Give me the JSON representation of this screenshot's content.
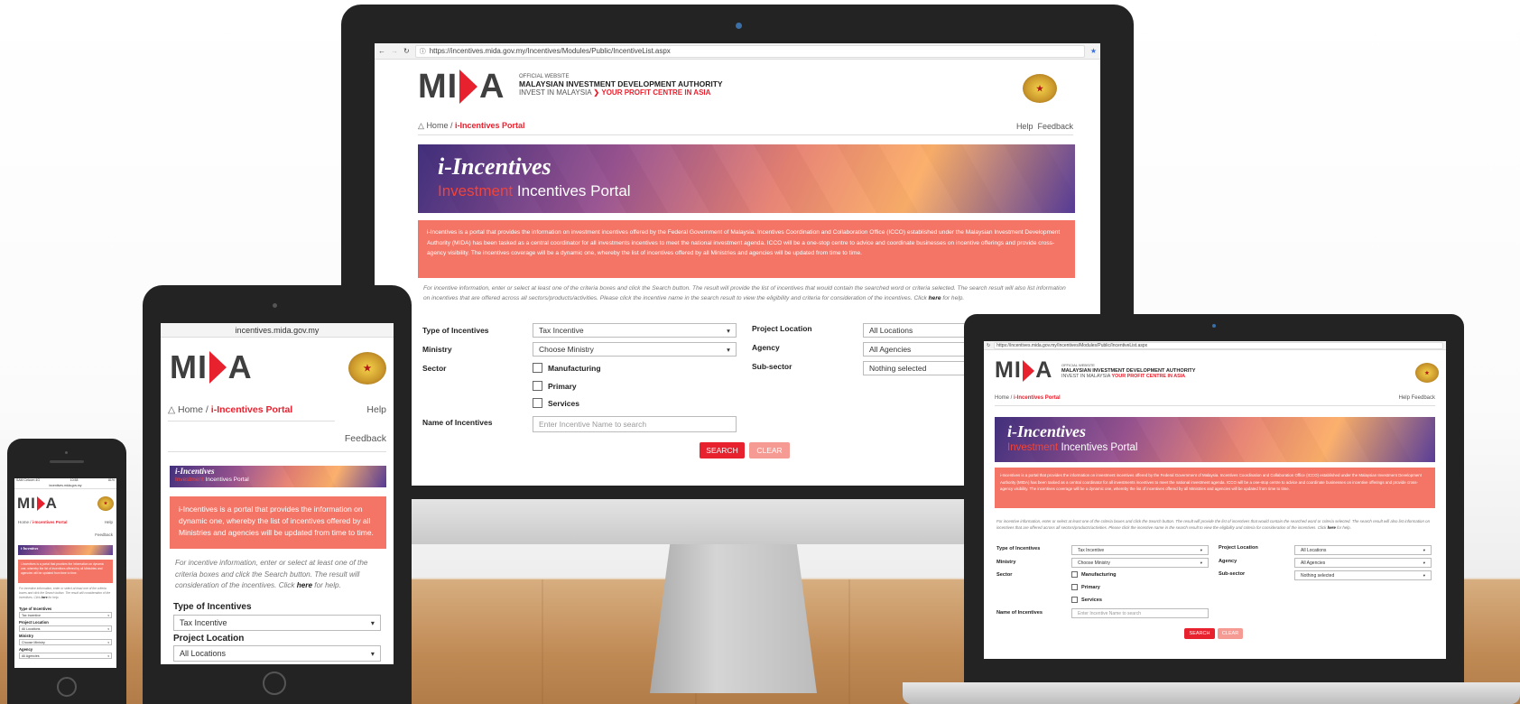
{
  "browser": {
    "url": "https://incentives.mida.gov.my/Incentives/Modules/Public/IncentiveList.aspx",
    "mobile_url": "incentives.mida.gov.my",
    "phone_time": "10:58",
    "phone_carrier": "SAM Celcom 4G",
    "phone_battery": "81%"
  },
  "logo": {
    "text_a": "MI",
    "text_b": "A"
  },
  "header": {
    "official": "OFFICIAL WEBSITE",
    "org": "MALAYSIAN INVESTMENT DEVELOPMENT AUTHORITY",
    "tagline_a": "INVEST IN MALAYSIA",
    "tagline_b": "YOUR PROFIT CENTRE IN ASIA"
  },
  "nav": {
    "home": "Home",
    "current": "i-Incentives Portal",
    "help": "Help",
    "feedback": "Feedback"
  },
  "banner": {
    "title": "i-Incentives",
    "sub_red": "Investment",
    "sub_white": "Incentives Portal"
  },
  "intro": {
    "text": "i-Incentives is a portal that provides the information on investment incentives offered by the Federal Government of Malaysia. Incentives Coordination and Collaboration Office (ICCO) established under the Malaysian Investment Development Authority (MIDA) has been tasked as a central coordinator for all investments incentives to meet the national investment agenda. ICCO will be a one-stop centre to advice and coordinate businesses on incentive offerings and provide cross-agency visibility. The incentives coverage will be a dynamic one, whereby the list of incentives offered by all Ministries and agencies will be updated from time to time.",
    "tablet_text": "i-Incentives is a portal that provides the information on dynamic one, whereby the list of incentives offered by all Ministries and agencies will be updated from time to time."
  },
  "help_text": {
    "a": "For incentive information, enter or select at least one of the criteria boxes and click the Search button. The result will provide the list of incentives that would contain the searched word or criteria selected. The search result will also list information on incentives that are offered across all sectors/products/activities. Please click the incentive name in the search result to view the eligibility and criteria for consideration of the incentives. Click ",
    "here": "here",
    "b": " for help.",
    "tablet_a": "For incentive information, enter or select at least one of the criteria boxes and click the Search button. The result will consideration of the incentives. Click "
  },
  "form": {
    "type_label": "Type of Incentives",
    "type_value": "Tax Incentive",
    "ministry_label": "Ministry",
    "ministry_value": "Choose Ministry",
    "sector_label": "Sector",
    "sectors": [
      "Manufacturing",
      "Primary",
      "Services"
    ],
    "name_label": "Name of Incentives",
    "name_placeholder": "Enter Incentive Name to search",
    "location_label": "Project Location",
    "location_value": "All Locations",
    "agency_label": "Agency",
    "agency_value": "All Agencies",
    "subsector_label": "Sub-sector",
    "subsector_value": "Nothing selected",
    "search": "SEARCH",
    "clear": "CLEAR"
  }
}
